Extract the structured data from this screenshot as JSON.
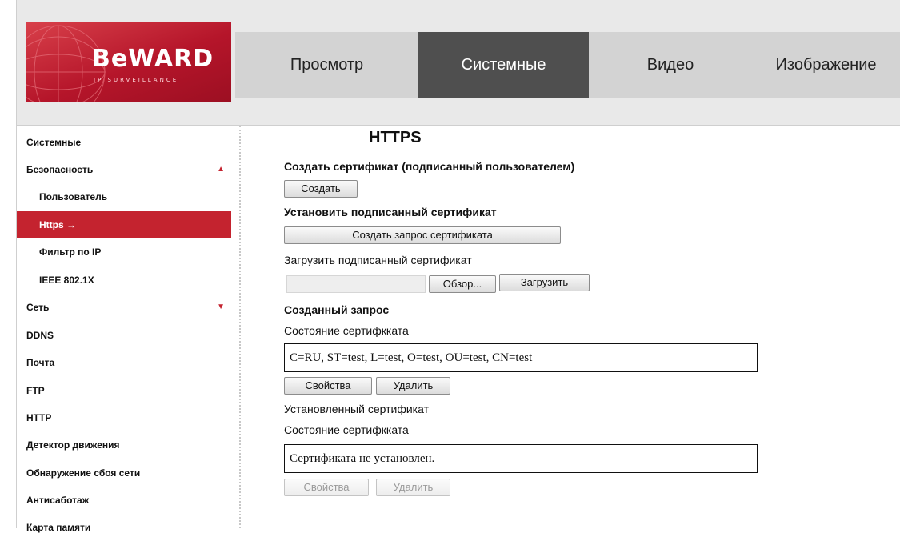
{
  "logo": {
    "main": "BeWARD",
    "sub": "IP SURVEILLANCE"
  },
  "nav": {
    "tabs": [
      {
        "label": "Просмотр"
      },
      {
        "label": "Системные"
      },
      {
        "label": "Видео"
      },
      {
        "label": "Изображение"
      }
    ],
    "active_tab": "Системные"
  },
  "sidebar": {
    "items": [
      {
        "label": "Системные"
      },
      {
        "label": "Безопасность"
      },
      {
        "label": "Пользователь"
      },
      {
        "label": "Https →"
      },
      {
        "label": "Фильтр по IP"
      },
      {
        "label": "IEEE 802.1X"
      },
      {
        "label": "Сеть"
      },
      {
        "label": "DDNS"
      },
      {
        "label": "Почта"
      },
      {
        "label": "FTP"
      },
      {
        "label": "HTTP"
      },
      {
        "label": "Детектор движения"
      },
      {
        "label": "Обнаружение сбоя сети"
      },
      {
        "label": "Антисаботаж"
      },
      {
        "label": "Карта памяти"
      }
    ],
    "active_item": "Https →",
    "expanded_icon": "▲",
    "collapsed_icon": "▼"
  },
  "main": {
    "title": "HTTPS",
    "create_cert_heading": "Создать сертификат (подписанный пользователем)",
    "create_button": "Создать",
    "install_heading": "Установить подписанный сертификат",
    "create_request_button": "Создать запрос сертификата",
    "upload_label": "Загрузить подписанный сертификат",
    "browse_button": "Обзор...",
    "upload_button": "Загрузить",
    "created_request_heading": "Созданный запрос",
    "request_status_label": "Состояние сертифкката",
    "request_status_value": "C=RU, ST=test, L=test, O=test, OU=test, CN=test",
    "properties_button": "Свойства",
    "delete_button": "Удалить",
    "installed_cert_label": "Установленный сертификат",
    "installed_status_label": "Состояние сертифкката",
    "installed_status_value": "Сертификата не установлен.",
    "properties_button_disabled": "Свойства",
    "delete_button_disabled": "Удалить"
  },
  "colors": {
    "accent": "#c4232f",
    "active_tab": "#4f4f4f",
    "nav_bg": "#d3d3d3"
  }
}
